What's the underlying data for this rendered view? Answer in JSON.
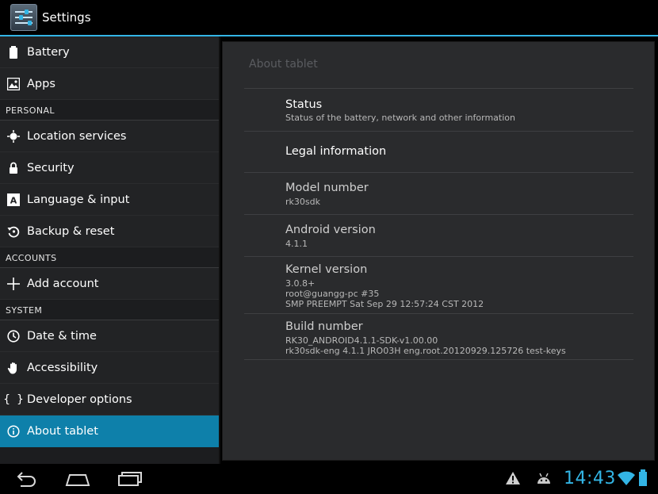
{
  "actionbar": {
    "title": "Settings",
    "icon": "settings-icon"
  },
  "sidebar": {
    "top_items": [
      {
        "label": "Battery",
        "icon": "battery-icon"
      },
      {
        "label": "Apps",
        "icon": "apps-icon"
      }
    ],
    "sections": [
      {
        "header": "PERSONAL",
        "items": [
          {
            "label": "Location services",
            "icon": "location-icon"
          },
          {
            "label": "Security",
            "icon": "lock-icon"
          },
          {
            "label": "Language & input",
            "icon": "language-icon"
          },
          {
            "label": "Backup & reset",
            "icon": "backup-icon"
          }
        ]
      },
      {
        "header": "ACCOUNTS",
        "items": [
          {
            "label": "Add account",
            "icon": "plus-icon"
          }
        ]
      },
      {
        "header": "SYSTEM",
        "items": [
          {
            "label": "Date & time",
            "icon": "clock-icon"
          },
          {
            "label": "Accessibility",
            "icon": "hand-icon"
          },
          {
            "label": "Developer options",
            "icon": "braces-icon"
          },
          {
            "label": "About tablet",
            "icon": "info-icon",
            "active": true
          }
        ]
      }
    ]
  },
  "about": {
    "title": "About tablet",
    "items": [
      {
        "title": "Status",
        "summary": [
          "Status of the battery, network and other information"
        ]
      },
      {
        "title": "Legal information",
        "summary": []
      },
      {
        "title": "Model number",
        "summary": [
          "rk30sdk"
        ]
      },
      {
        "title": "Android version",
        "summary": [
          "4.1.1"
        ]
      },
      {
        "title": "Kernel version",
        "summary": [
          "3.0.8+",
          "root@guangg-pc #35",
          "SMP PREEMPT Sat Sep 29 12:57:24 CST 2012"
        ]
      },
      {
        "title": "Build number",
        "summary": [
          "RK30_ANDROID4.1.1-SDK-v1.00.00",
          "rk30sdk-eng 4.1.1 JRO03H eng.root.20120929.125726 test-keys"
        ]
      }
    ]
  },
  "statusbar": {
    "clock": "14:43",
    "accent": "#33b5e5",
    "icons": [
      "back-icon",
      "home-icon",
      "recent-apps-icon",
      "warning-icon",
      "android-debug-icon",
      "wifi-icon",
      "battery-status-icon"
    ]
  }
}
